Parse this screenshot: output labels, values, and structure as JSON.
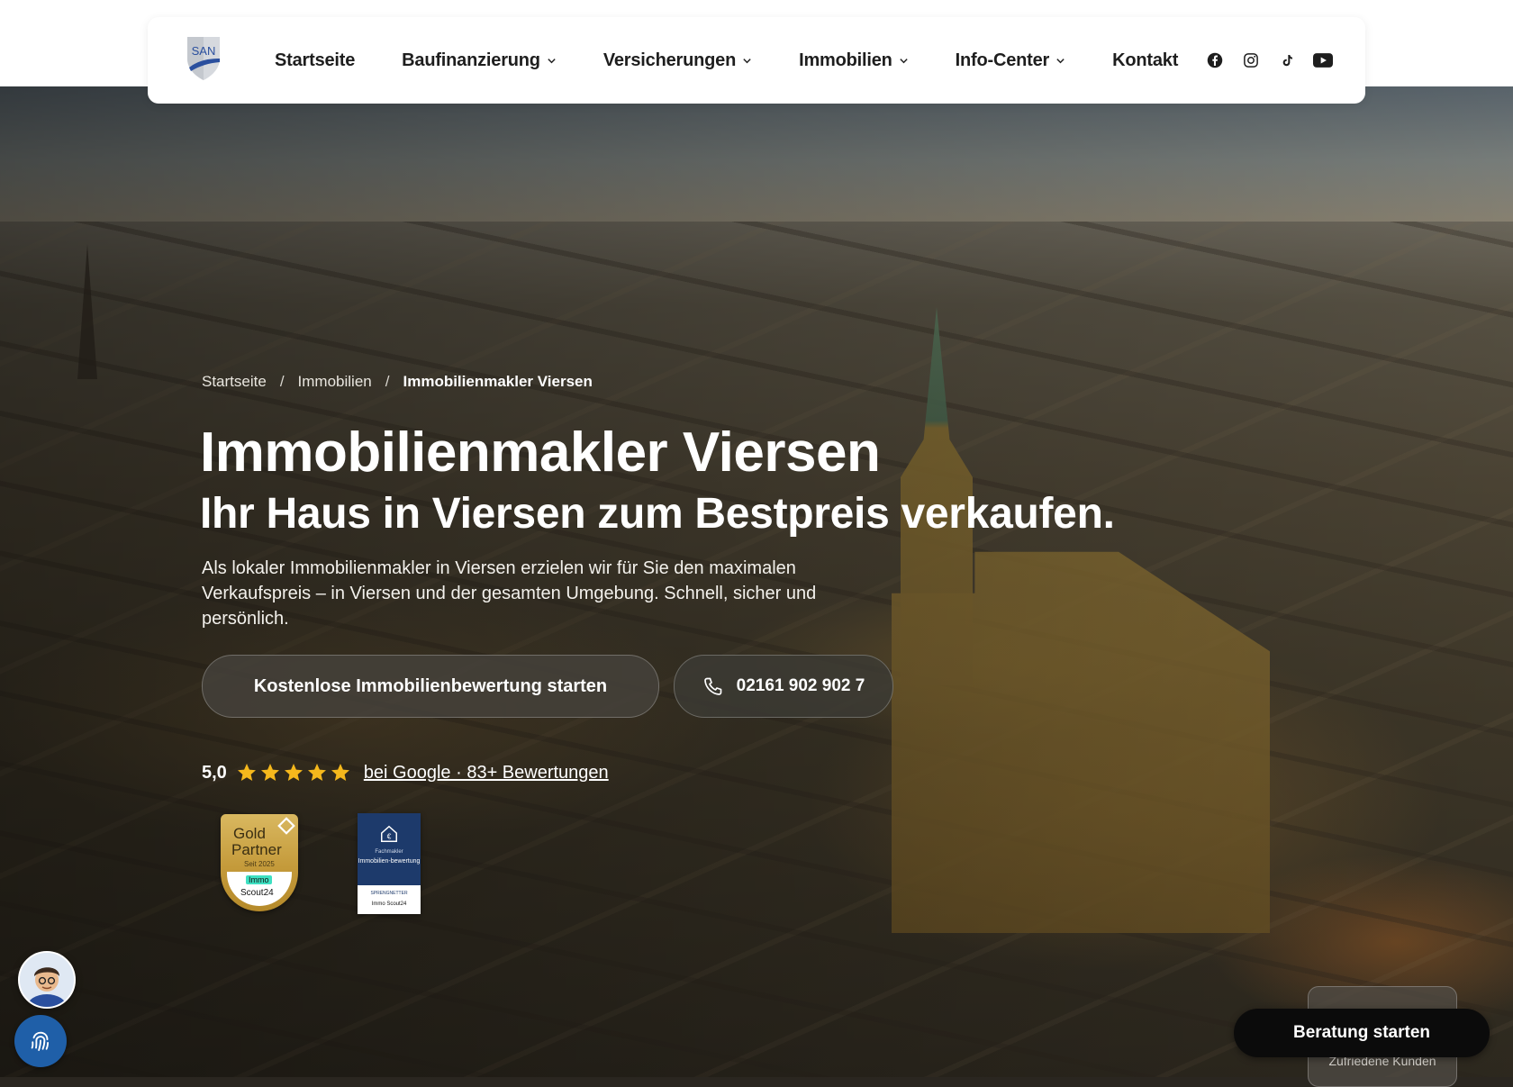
{
  "nav": {
    "logo_text": "SAN",
    "items": [
      {
        "label": "Startseite",
        "has_dropdown": false
      },
      {
        "label": "Baufinanzierung",
        "has_dropdown": true
      },
      {
        "label": "Versicherungen",
        "has_dropdown": true
      },
      {
        "label": "Immobilien",
        "has_dropdown": true
      },
      {
        "label": "Info-Center",
        "has_dropdown": true
      },
      {
        "label": "Kontakt",
        "has_dropdown": false
      }
    ],
    "socials": [
      "facebook-icon",
      "instagram-icon",
      "tiktok-icon",
      "youtube-icon"
    ]
  },
  "breadcrumb": {
    "items": [
      "Startseite",
      "Immobilien"
    ],
    "current": "Immobilienmakler Viersen",
    "separator": "/"
  },
  "hero": {
    "title": "Immobilienmakler Viersen",
    "subtitle": "Ihr Haus in Viersen zum Bestpreis verkaufen.",
    "lead": "Als lokaler Immobilienmakler in Viersen erzielen wir für Sie den maximalen Verkaufspreis – in Viersen und der gesamten Umgebung. Schnell, sicher und persönlich.",
    "cta_primary": "Kostenlose Immobilienbewertung starten",
    "cta_phone": "02161 902 902 7"
  },
  "rating": {
    "score": "5,0",
    "stars": 5,
    "link_text": "bei Google · 83+ Bewertungen"
  },
  "badges": {
    "gold": {
      "line1": "Gold",
      "line2": "Partner",
      "since": "Seit 2025",
      "brand1": "Immo",
      "brand2": "Scout24"
    },
    "blue": {
      "small": "Fachmakler",
      "title": "Immobilien-bewertung",
      "partner": "SPRENGNETTER",
      "brand": "Immo Scout24"
    }
  },
  "widgets": {
    "beratung_label": "Beratung starten",
    "review_card_text": "Zufriedene Kunden"
  },
  "colors": {
    "cta_dark": "#0b0b0b",
    "star": "#f5b81c",
    "fingerprint_bg": "#1f5fa8",
    "logo_blue": "#2a4f9e"
  }
}
